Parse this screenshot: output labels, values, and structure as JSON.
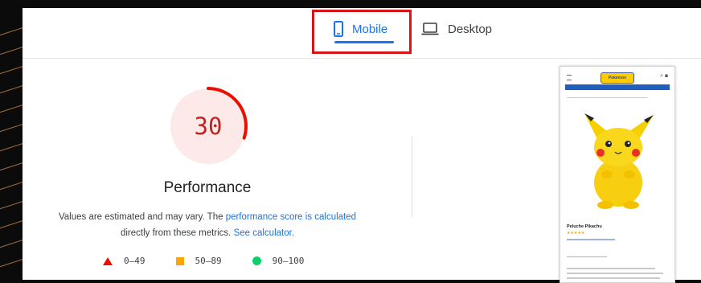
{
  "tabs": {
    "mobile_label": "Mobile",
    "desktop_label": "Desktop",
    "active": "mobile",
    "active_color": "#1a73e8"
  },
  "highlight_color": "#d8141b",
  "score": {
    "value": "30",
    "fraction": 0.3,
    "color": "#c5221f",
    "ring_color": "#eb0f00",
    "bg_color": "#fde9e8"
  },
  "category": {
    "title": "Performance",
    "desc_prefix": "Values are estimated and may vary. The ",
    "desc_link": "performance score is calculated",
    "desc_middle": "directly from these metrics. ",
    "desc_link2": "See calculator."
  },
  "legend": [
    {
      "range": "0–49",
      "icon": "triangle-icon",
      "color": "#eb0f00"
    },
    {
      "range": "50–89",
      "icon": "square-icon",
      "color": "#ffa400"
    },
    {
      "range": "90–100",
      "icon": "circle-icon",
      "color": "#0cce6b"
    }
  ],
  "screenshot": {
    "logo_text": "Pokémon",
    "product_name": "Peluche Pikachu",
    "stars": "★★★★★"
  }
}
